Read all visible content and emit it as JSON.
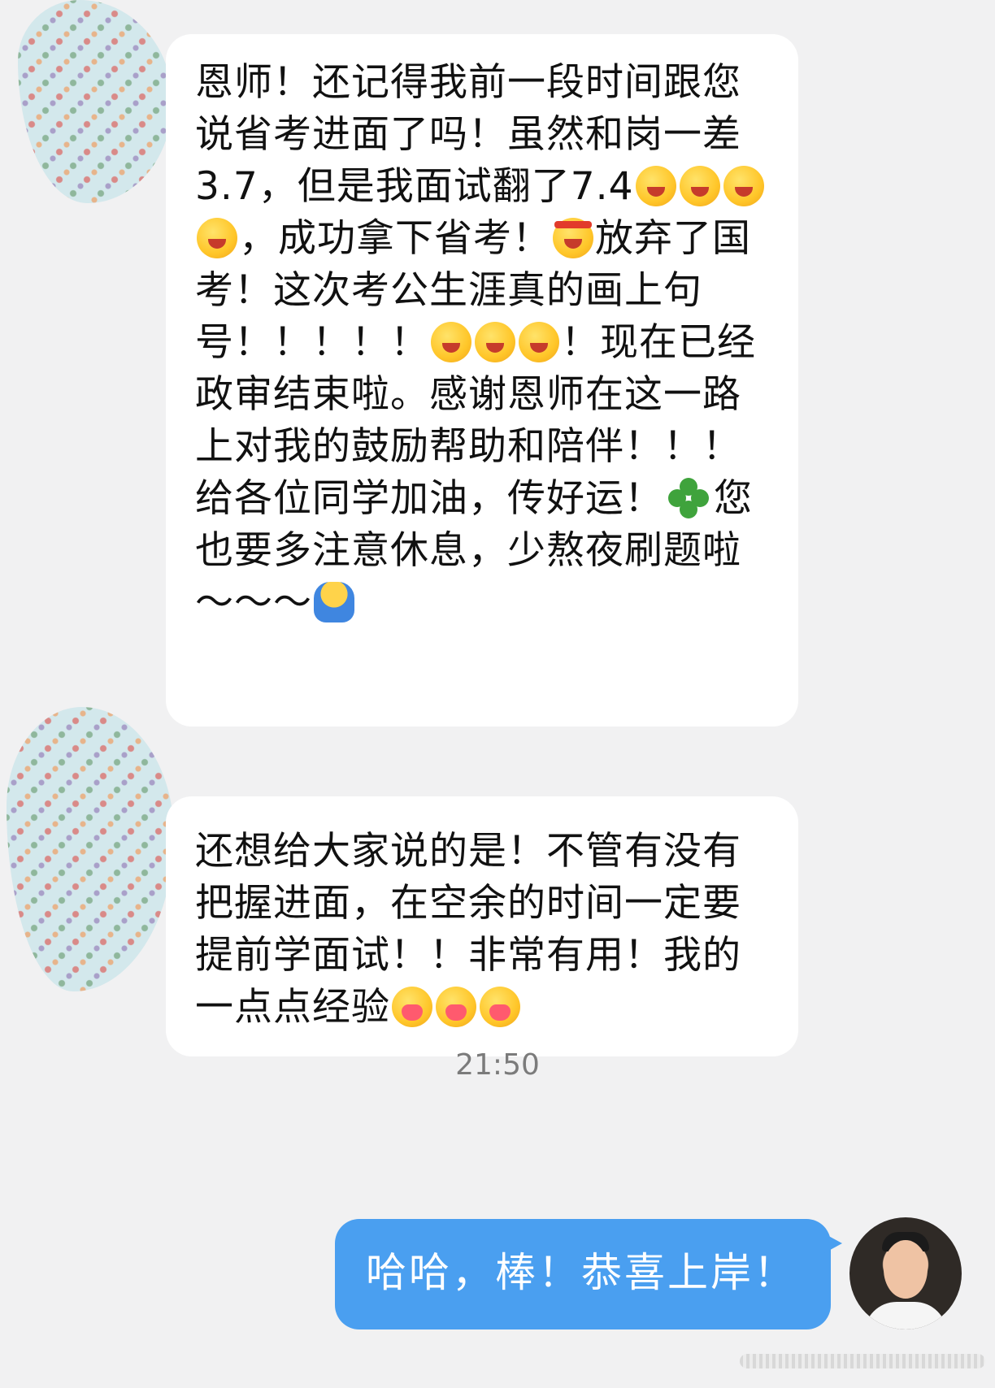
{
  "messages": [
    {
      "sender": "contact",
      "segments": [
        {
          "text": "恩师！还记得我前一段时间跟您说省考进面了吗！虽然和岗一差3.7，但是我面试翻了7.4"
        },
        {
          "emoji": "flower-face-emoji"
        },
        {
          "emoji": "flower-face-emoji"
        },
        {
          "emoji": "flower-face-emoji"
        },
        {
          "emoji": "flower-face-emoji"
        },
        {
          "text": "，成功拿下省考！"
        },
        {
          "emoji": "fighting-emoji"
        },
        {
          "text": "放弃了国考！这次考公生涯真的画上句号！！！！！"
        },
        {
          "emoji": "laugh-emoji"
        },
        {
          "emoji": "laugh-emoji"
        },
        {
          "emoji": "laugh-emoji"
        },
        {
          "text": "！现在已经政审结束啦。感谢恩师在这一路上对我的鼓励帮助和陪伴！！！给各位同学加油，传好运！"
        },
        {
          "emoji": "clover-emoji"
        },
        {
          "text": "您也要多注意休息，少熬夜刷题啦～～～"
        },
        {
          "emoji": "hug-person-emoji"
        }
      ]
    },
    {
      "sender": "contact",
      "segments": [
        {
          "text": "还想给大家说的是！不管有没有把握进面，在空余的时间一定要提前学面试！！非常有用！我的一点点经验"
        },
        {
          "emoji": "heart-hug-emoji"
        },
        {
          "emoji": "heart-hug-emoji"
        },
        {
          "emoji": "heart-hug-emoji"
        }
      ]
    }
  ],
  "timestamp": "21:50",
  "reply": {
    "sender": "me",
    "text": "哈哈，棒！恭喜上岸！"
  },
  "colors": {
    "background": "#f1f1f2",
    "incoming_bubble": "#ffffff",
    "outgoing_bubble": "#4a9ff0",
    "timestamp": "#7b7b7b"
  }
}
